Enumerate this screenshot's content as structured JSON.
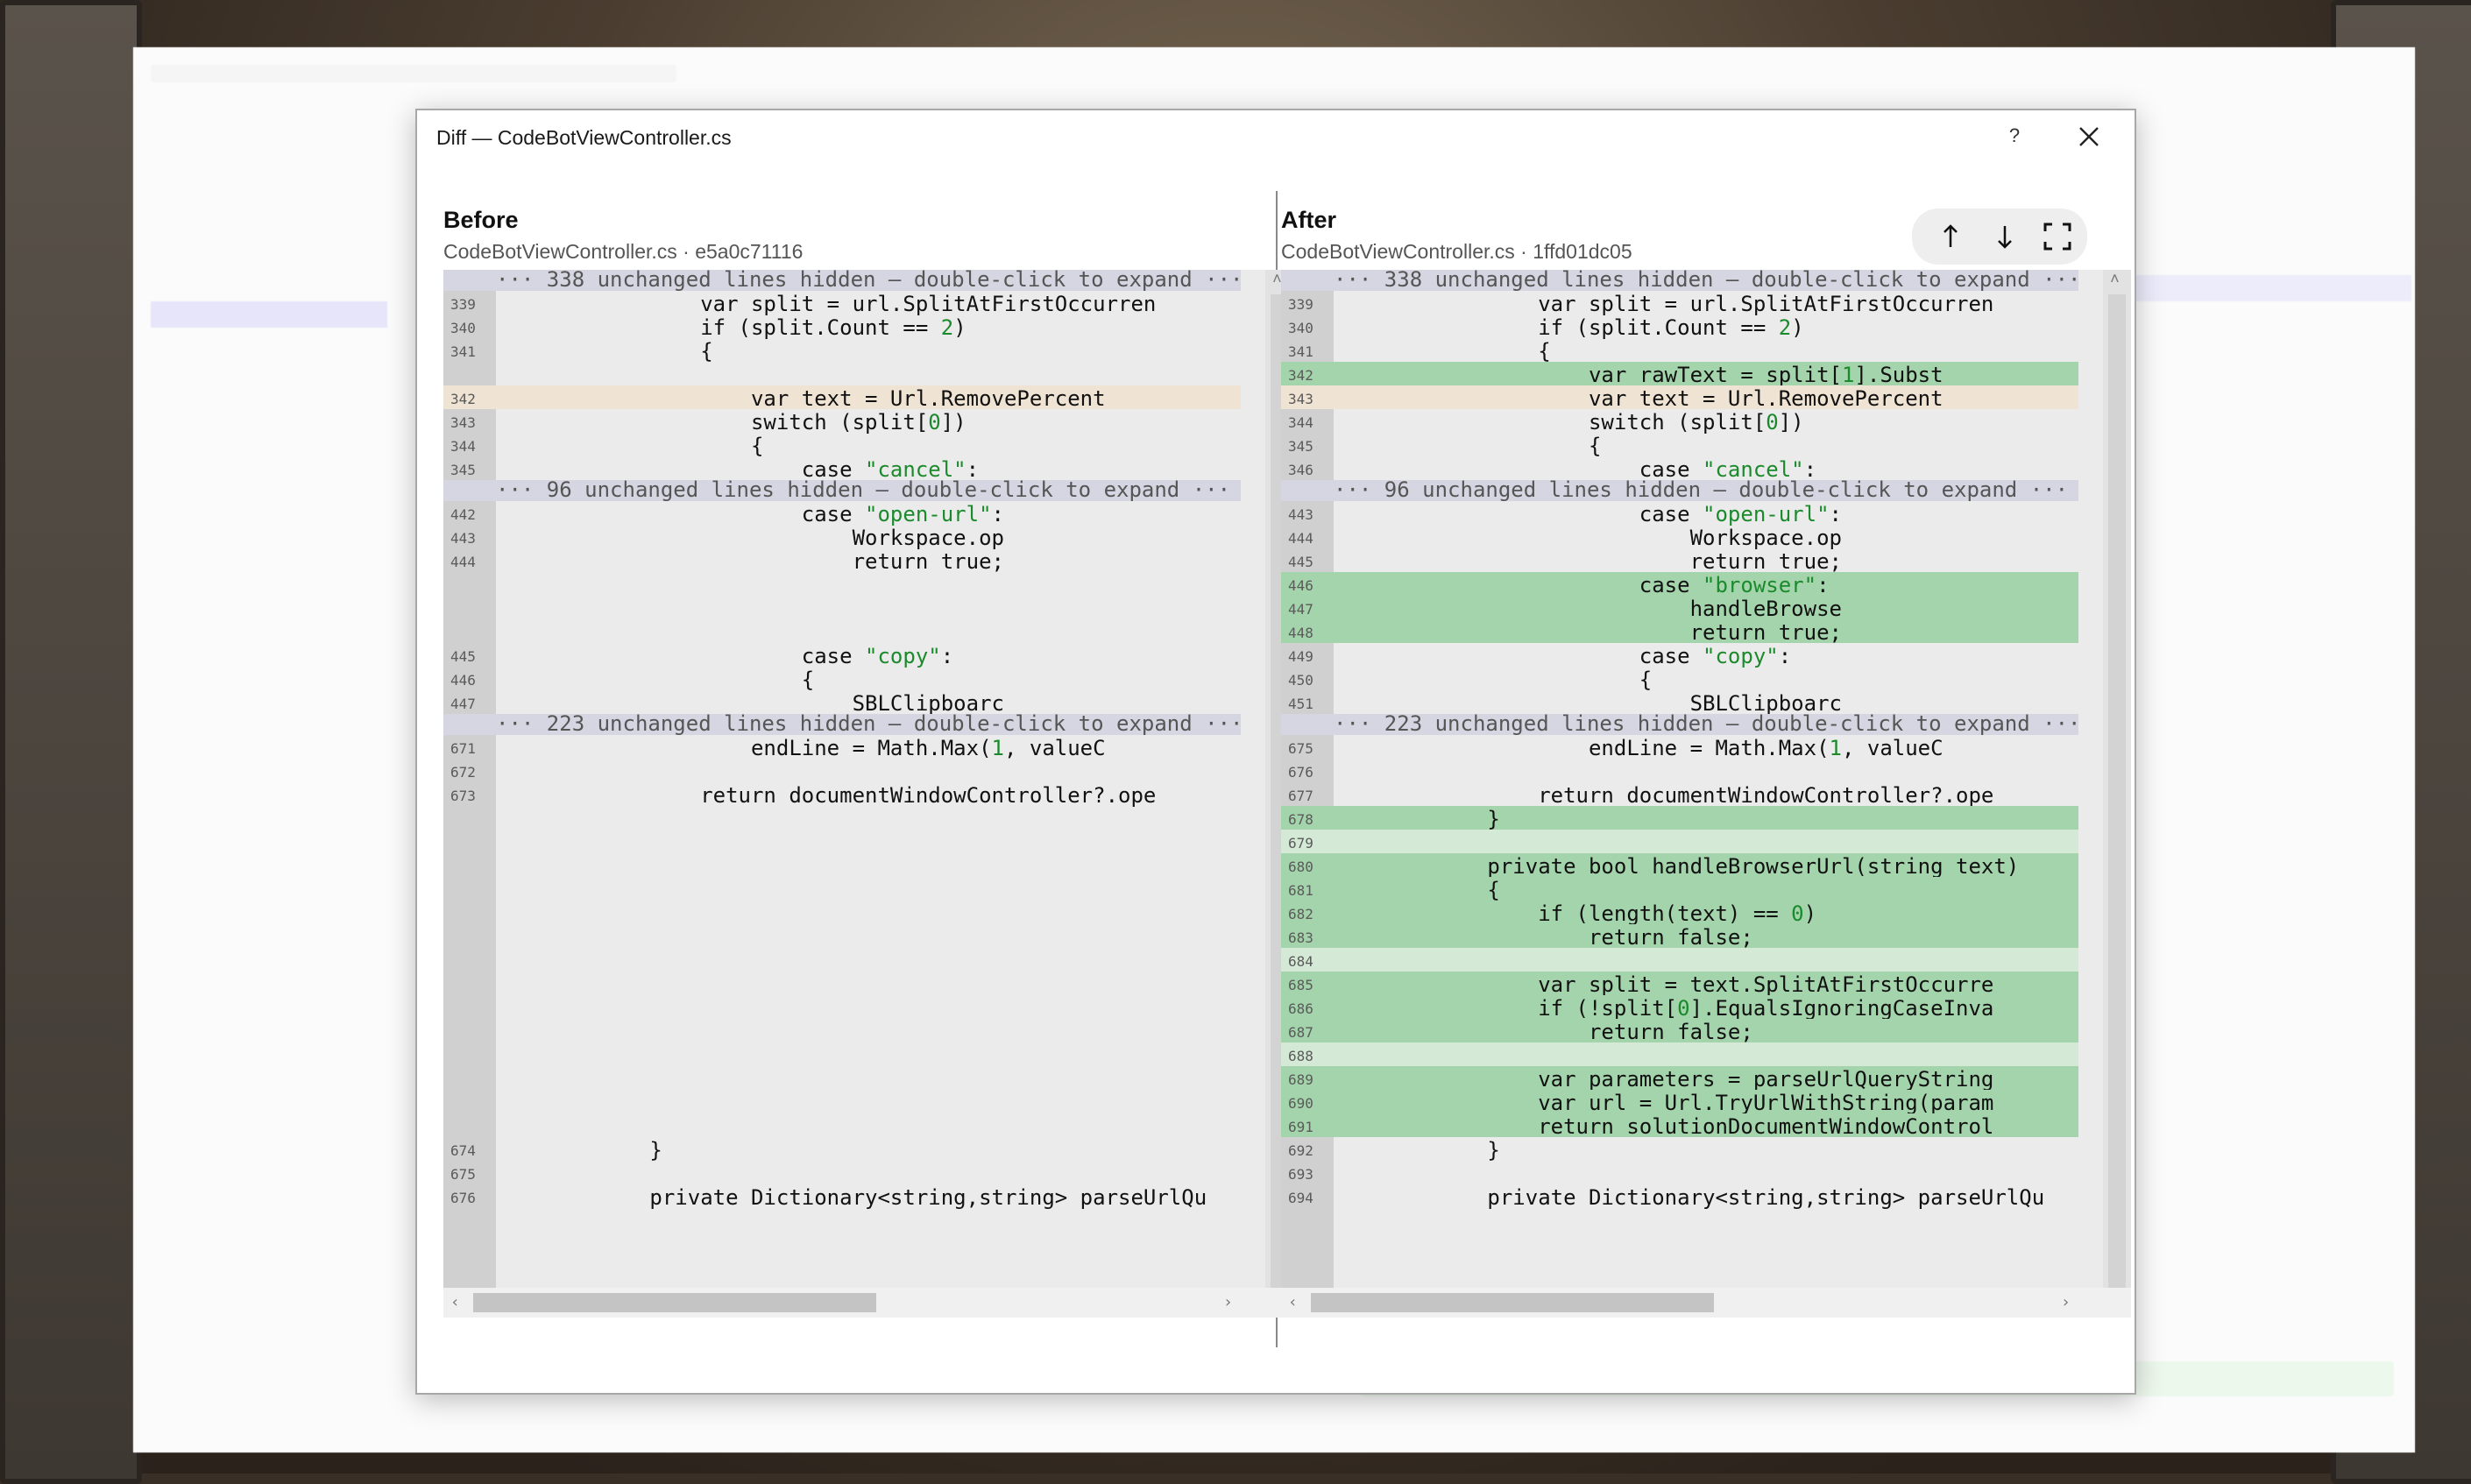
{
  "dialog": {
    "title": "Diff — CodeBotViewController.cs",
    "help_label": "?",
    "close_icon": "close-icon"
  },
  "before": {
    "title": "Before",
    "subtitle": "CodeBotViewController.cs · e5a0c71116"
  },
  "after": {
    "title": "After",
    "subtitle": "CodeBotViewController.cs · 1ffd01dc05"
  },
  "toolbar": {
    "prev_icon": "arrow-up-icon",
    "next_icon": "arrow-down-icon",
    "fullscreen_icon": "fullscreen-icon"
  },
  "left_lines": [
    {
      "num": "",
      "text": "··· 338 unchanged lines hidden — double-click to expand ···",
      "kind": "hidden"
    },
    {
      "num": "339",
      "text": "                var split = url.SplitAtFirstOccurren",
      "kind": "normal"
    },
    {
      "num": "340",
      "text": "                if (split.Count == 2)",
      "kind": "normal"
    },
    {
      "num": "341",
      "text": "                {",
      "kind": "normal"
    },
    {
      "num": "",
      "text": "",
      "kind": "normal"
    },
    {
      "num": "342",
      "text": "                    var text = Url.RemovePercent",
      "kind": "changed"
    },
    {
      "num": "343",
      "text": "                    switch (split[0])",
      "kind": "normal"
    },
    {
      "num": "344",
      "text": "                    {",
      "kind": "normal"
    },
    {
      "num": "345",
      "text": "                        case \"cancel\":",
      "kind": "normal"
    },
    {
      "num": "",
      "text": "··· 96 unchanged lines hidden — double-click to expand ···",
      "kind": "hidden"
    },
    {
      "num": "442",
      "text": "                        case \"open-url\":",
      "kind": "normal"
    },
    {
      "num": "443",
      "text": "                            Workspace.op",
      "kind": "normal"
    },
    {
      "num": "444",
      "text": "                            return true;",
      "kind": "normal"
    },
    {
      "num": "",
      "text": "",
      "kind": "gap"
    },
    {
      "num": "",
      "text": "",
      "kind": "gap"
    },
    {
      "num": "",
      "text": "",
      "kind": "gap"
    },
    {
      "num": "445",
      "text": "                        case \"copy\":",
      "kind": "normal"
    },
    {
      "num": "446",
      "text": "                        {",
      "kind": "normal"
    },
    {
      "num": "447",
      "text": "                            SBLClipboarc",
      "kind": "normal"
    },
    {
      "num": "",
      "text": "··· 223 unchanged lines hidden — double-click to expand ···",
      "kind": "hidden"
    },
    {
      "num": "671",
      "text": "                    endLine = Math.Max(1, valueC",
      "kind": "normal"
    },
    {
      "num": "672",
      "text": "",
      "kind": "normal"
    },
    {
      "num": "673",
      "text": "                return documentWindowController?.ope",
      "kind": "normal"
    },
    {
      "num": "674",
      "text": "            }",
      "kind": "normal"
    },
    {
      "num": "675",
      "text": "",
      "kind": "normal"
    },
    {
      "num": "676",
      "text": "            private Dictionary<string,string> parseUrlQu",
      "kind": "normal"
    }
  ],
  "right_lines": [
    {
      "num": "",
      "text": "··· 338 unchanged lines hidden — double-click to expand ···",
      "kind": "hidden"
    },
    {
      "num": "339",
      "text": "                var split = url.SplitAtFirstOccurren",
      "kind": "normal"
    },
    {
      "num": "340",
      "text": "                if (split.Count == 2)",
      "kind": "normal"
    },
    {
      "num": "341",
      "text": "                {",
      "kind": "normal"
    },
    {
      "num": "342",
      "text": "                    var rawText = split[1].Subst",
      "kind": "added"
    },
    {
      "num": "343",
      "text": "                    var text = Url.RemovePercent",
      "kind": "changed"
    },
    {
      "num": "344",
      "text": "                    switch (split[0])",
      "kind": "normal"
    },
    {
      "num": "345",
      "text": "                    {",
      "kind": "normal"
    },
    {
      "num": "346",
      "text": "                        case \"cancel\":",
      "kind": "normal"
    },
    {
      "num": "",
      "text": "··· 96 unchanged lines hidden — double-click to expand ···",
      "kind": "hidden"
    },
    {
      "num": "443",
      "text": "                        case \"open-url\":",
      "kind": "normal"
    },
    {
      "num": "444",
      "text": "                            Workspace.op",
      "kind": "normal"
    },
    {
      "num": "445",
      "text": "                            return true;",
      "kind": "normal"
    },
    {
      "num": "446",
      "text": "                        case \"browser\":",
      "kind": "added"
    },
    {
      "num": "447",
      "text": "                            handleBrowse",
      "kind": "added"
    },
    {
      "num": "448",
      "text": "                            return true;",
      "kind": "added"
    },
    {
      "num": "449",
      "text": "                        case \"copy\":",
      "kind": "normal"
    },
    {
      "num": "450",
      "text": "                        {",
      "kind": "normal"
    },
    {
      "num": "451",
      "text": "                            SBLClipboarc",
      "kind": "normal"
    },
    {
      "num": "",
      "text": "··· 223 unchanged lines hidden — double-click to expand ···",
      "kind": "hidden"
    },
    {
      "num": "675",
      "text": "                    endLine = Math.Max(1, valueC",
      "kind": "normal"
    },
    {
      "num": "676",
      "text": "",
      "kind": "normal"
    },
    {
      "num": "677",
      "text": "                return documentWindowController?.ope",
      "kind": "normal"
    },
    {
      "num": "678",
      "text": "            }",
      "kind": "added"
    },
    {
      "num": "679",
      "text": "",
      "kind": "added-light"
    },
    {
      "num": "680",
      "text": "            private bool handleBrowserUrl(string text)",
      "kind": "added"
    },
    {
      "num": "681",
      "text": "            {",
      "kind": "added"
    },
    {
      "num": "682",
      "text": "                if (length(text) == 0)",
      "kind": "added"
    },
    {
      "num": "683",
      "text": "                    return false;",
      "kind": "added"
    },
    {
      "num": "684",
      "text": "",
      "kind": "added-light"
    },
    {
      "num": "685",
      "text": "                var split = text.SplitAtFirstOccurre",
      "kind": "added"
    },
    {
      "num": "686",
      "text": "                if (!split[0].EqualsIgnoringCaseInva",
      "kind": "added"
    },
    {
      "num": "687",
      "text": "                    return false;",
      "kind": "added"
    },
    {
      "num": "688",
      "text": "",
      "kind": "added-light"
    },
    {
      "num": "689",
      "text": "                var parameters = parseUrlQueryString",
      "kind": "added"
    },
    {
      "num": "690",
      "text": "                var url = Url.TryUrlWithString(param",
      "kind": "added"
    },
    {
      "num": "691",
      "text": "                return solutionDocumentWindowControl",
      "kind": "added"
    },
    {
      "num": "692",
      "text": "            }",
      "kind": "normal"
    },
    {
      "num": "693",
      "text": "",
      "kind": "normal"
    },
    {
      "num": "694",
      "text": "            private Dictionary<string,string> parseUrlQu",
      "kind": "normal"
    }
  ]
}
